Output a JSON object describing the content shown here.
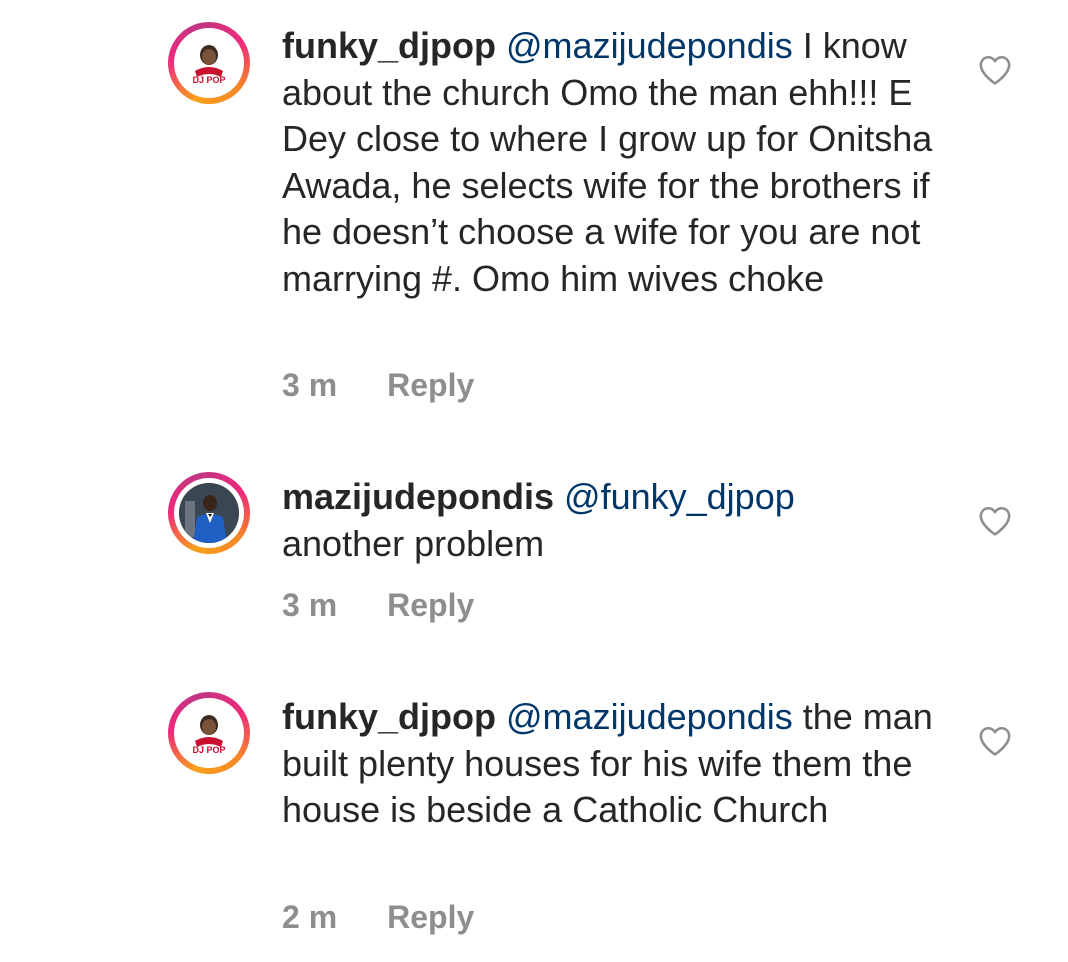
{
  "comments": [
    {
      "username": "funky_djpop",
      "mention": "@mazijudepondis",
      "text": " I know about the church Omo the man ehh!!! E Dey close to where I grow up for Onitsha Awada, he selects wife for the brothers if he doesn’t choose a wife for you are not marrying #. Omo him wives choke",
      "time": "3 m",
      "reply_label": "Reply",
      "avatar_icon": "dj-logo-avatar",
      "avatar_text": "DJ POP"
    },
    {
      "username": "mazijudepondis",
      "mention": "@funky_djpop",
      "text": " another problem",
      "time": "3 m",
      "reply_label": "Reply",
      "avatar_icon": "man-in-blue-suit-avatar"
    },
    {
      "username": "funky_djpop",
      "mention": "@mazijudepondis",
      "text": " the man built plenty houses for his wife them the house is beside a Catholic Church",
      "time": "2 m",
      "reply_label": "Reply",
      "avatar_icon": "dj-logo-avatar",
      "avatar_text": "DJ POP"
    }
  ],
  "colors": {
    "text": "#262626",
    "mention": "#00376b",
    "meta": "#8e8e8e",
    "icon": "#8e8e8e"
  }
}
